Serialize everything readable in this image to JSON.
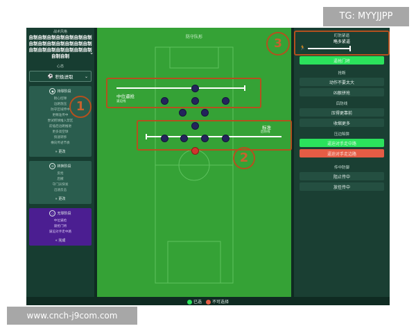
{
  "watermarks": {
    "top": "TG: MYYJJPP",
    "bottom": "www.cnch-j9com.com"
  },
  "sidebar": {
    "style_title": "战术风格",
    "style_name": "自制自制自制自制自制自制自制自制自制自制自制自制自制自制自制自制自制自制自制自制自制自制自制",
    "mentality_label": "心态",
    "mentality_value": "积极进取",
    "panels": [
      {
        "title": "持球阶段",
        "items": [
          "耐心控球",
          "边路施压",
          "防守区域传中",
          "更精准传中",
          "尝试把球推入禁区",
          "前插后边路推进",
          "更多高空球",
          "快速转移",
          "横向传递节奏"
        ],
        "more": "更改"
      },
      {
        "title": "转换阶段",
        "items": [
          "反抢",
          "后撤",
          "守门员快发",
          "迅速反击"
        ],
        "more": "更改"
      },
      {
        "title": "无球阶段",
        "items": [
          "中位逼抢",
          "逼抢门将",
          "逼迫对手走中路"
        ],
        "more": "完成"
      }
    ]
  },
  "pitch": {
    "title": "防守队形",
    "press_line_label": "中位逼抢",
    "press_line_sub": "逼迫线",
    "def_line_label": "标准",
    "def_line_sub": "后防线"
  },
  "annotations": [
    "1",
    "2",
    "3"
  ],
  "right_panel": {
    "marking_title": "盯防紧逼",
    "marking_value": "略多紧逼",
    "marking_level": 0.2,
    "marking_button": "逼抢门将",
    "sections": [
      {
        "title": "抢断",
        "buttons": [
          {
            "label": "动作不要太大",
            "style": "normal"
          },
          {
            "label": "凶狠拼抢",
            "style": "normal"
          }
        ]
      },
      {
        "title": "后防线",
        "buttons": [
          {
            "label": "压得更靠前",
            "style": "normal"
          },
          {
            "label": "收缩更多",
            "style": "normal"
          }
        ]
      },
      {
        "title": "压边陷阱",
        "buttons": [
          {
            "label": "逼迫对手走中路",
            "style": "green"
          },
          {
            "label": "逼迫对手走边路",
            "style": "red"
          }
        ]
      },
      {
        "title": "传中防御",
        "buttons": [
          {
            "label": "阻止传中",
            "style": "normal"
          },
          {
            "label": "放任传中",
            "style": "normal"
          }
        ]
      }
    ]
  },
  "legend": {
    "selected": "已选",
    "unavailable": "不可选择"
  },
  "colors": {
    "accent_green": "#2be25c",
    "accent_red": "#e55c45",
    "annotation": "#b5501e",
    "pitch": "#35a236"
  }
}
